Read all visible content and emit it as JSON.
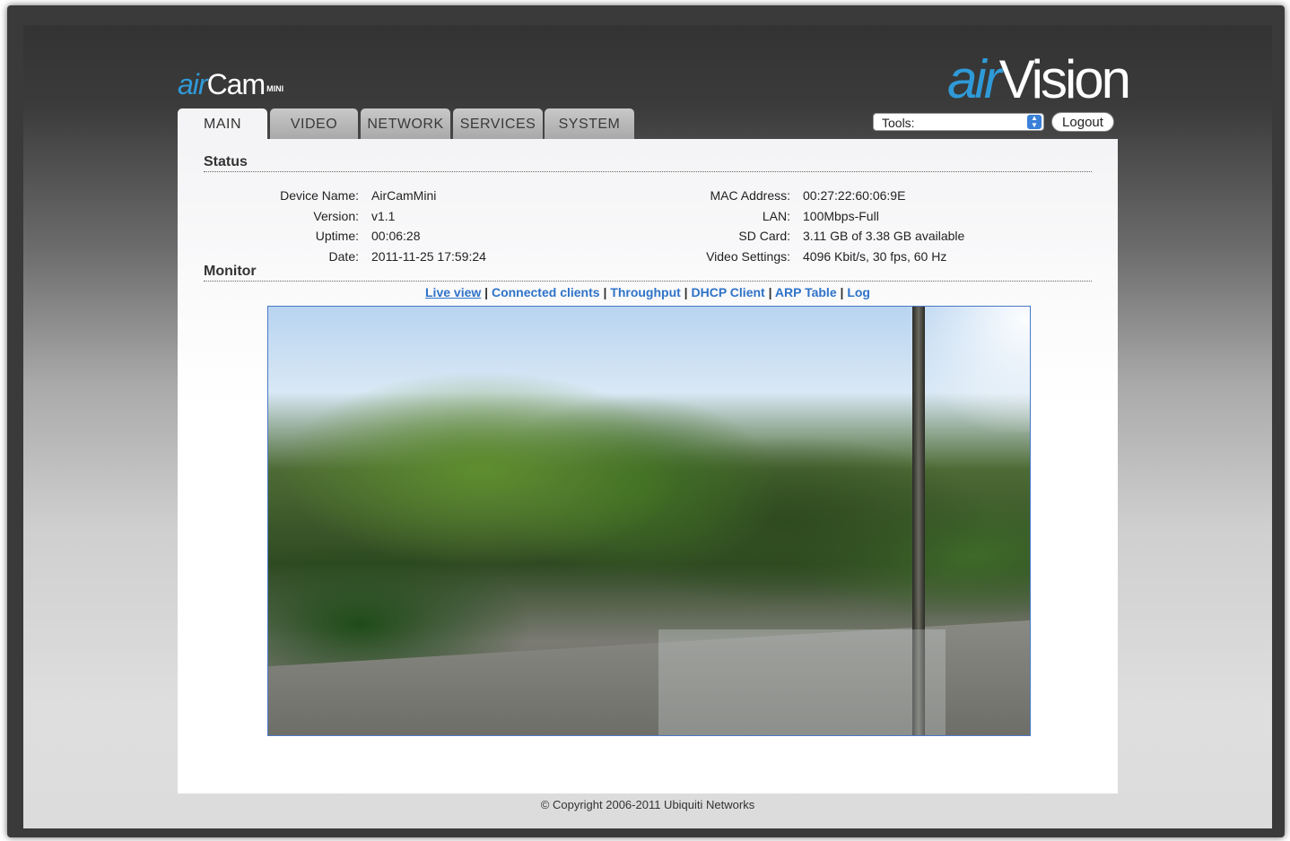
{
  "branding": {
    "left_logo": {
      "prefix": "air",
      "name": "Cam",
      "suffix": "MINI"
    },
    "right_logo": {
      "prefix": "air",
      "name": "Vision"
    },
    "accent_color": "#2f9ad8"
  },
  "tabs": [
    {
      "label": "MAIN",
      "active": true
    },
    {
      "label": "VIDEO",
      "active": false
    },
    {
      "label": "NETWORK",
      "active": false
    },
    {
      "label": "SERVICES",
      "active": false
    },
    {
      "label": "SYSTEM",
      "active": false
    }
  ],
  "header": {
    "tools_select": {
      "selected": "Tools:"
    },
    "logout_label": "Logout"
  },
  "status": {
    "title": "Status",
    "left": [
      {
        "label": "Device Name:",
        "value": "AirCamMini"
      },
      {
        "label": "Version:",
        "value": "v1.1"
      },
      {
        "label": "Uptime:",
        "value": "00:06:28"
      },
      {
        "label": "Date:",
        "value": "2011-11-25 17:59:24"
      }
    ],
    "right": [
      {
        "label": "MAC Address:",
        "value": "00:27:22:60:06:9E"
      },
      {
        "label": "LAN:",
        "value": "100Mbps-Full"
      },
      {
        "label": "SD Card:",
        "value": "3.11 GB of 3.38 GB available"
      },
      {
        "label": "Video Settings:",
        "value": "4096 Kbit/s, 30 fps, 60 Hz"
      }
    ]
  },
  "monitor": {
    "title": "Monitor",
    "links": [
      {
        "label": "Live view",
        "active": true
      },
      {
        "label": "Connected clients",
        "active": false
      },
      {
        "label": "Throughput",
        "active": false
      },
      {
        "label": "DHCP Client",
        "active": false
      },
      {
        "label": "ARP Table",
        "active": false
      },
      {
        "label": "Log",
        "active": false
      }
    ],
    "separator": " | "
  },
  "footer": {
    "copyright": "© Copyright 2006-2011 Ubiquiti Networks"
  }
}
